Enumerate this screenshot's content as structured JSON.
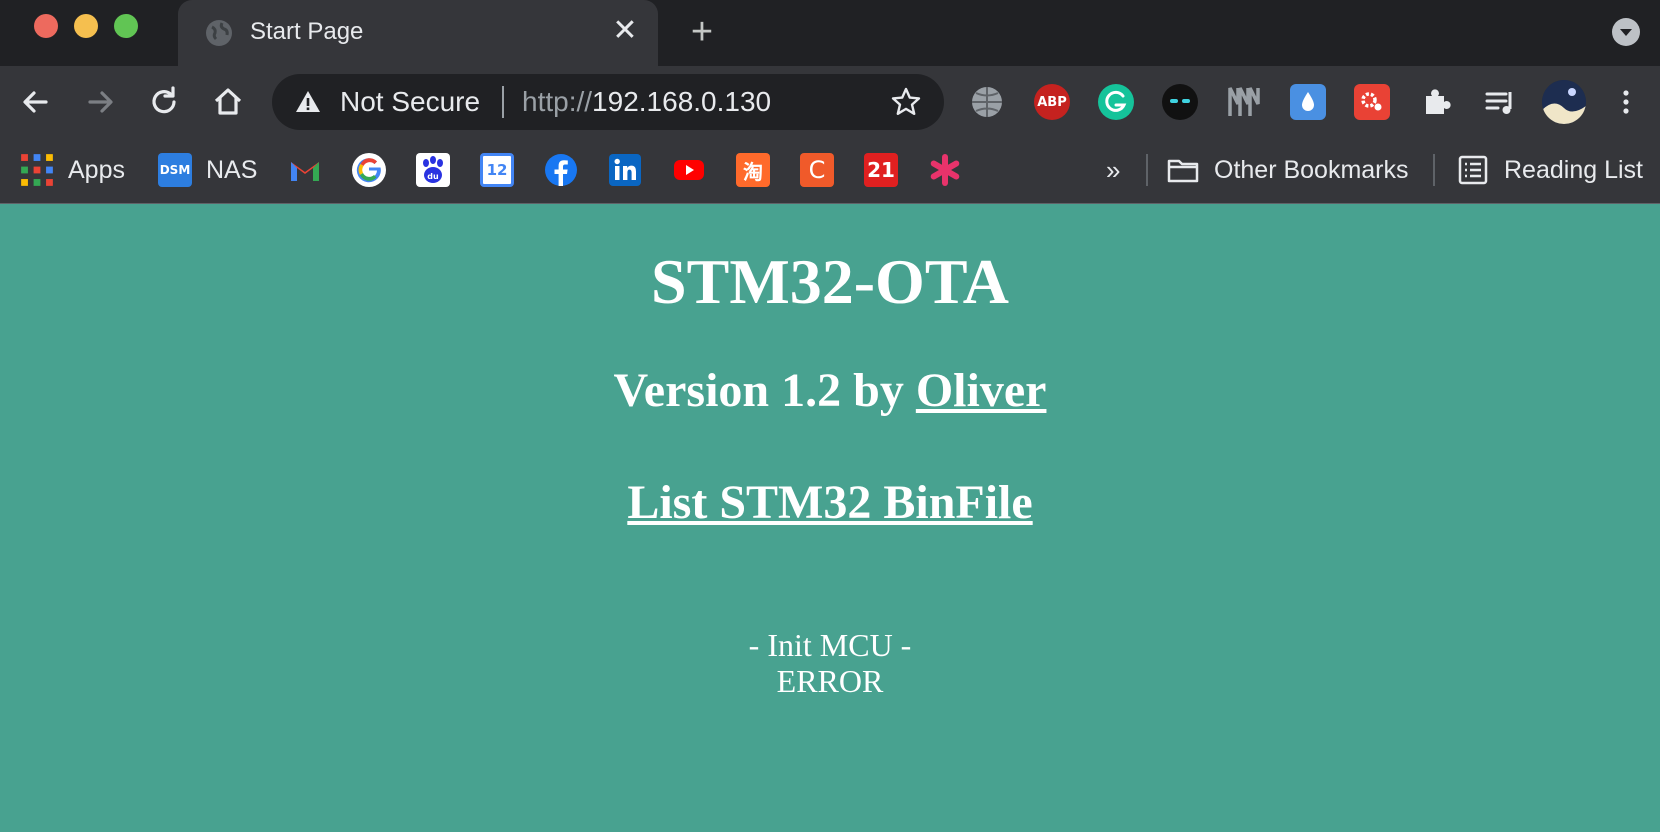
{
  "tab": {
    "title": "Start Page"
  },
  "omnibox": {
    "security": "Not Secure",
    "url_scheme": "http://",
    "url_host": "192.168.0.130"
  },
  "bookmarks": {
    "apps": "Apps",
    "nas": "NAS",
    "nas_icon": "DSM",
    "calendar_day": "12",
    "ext_21": "21",
    "ext_c": "C",
    "ext_tao": "淘",
    "more": "»",
    "other": "Other Bookmarks",
    "reading": "Reading List"
  },
  "extensions": {
    "abp": "ABP"
  },
  "page": {
    "title": "STM32-OTA",
    "version_prefix": "Version 1.2 by ",
    "author": "Oliver",
    "list_link": "List STM32 BinFile",
    "status_line1": "- Init MCU -",
    "status_line2": "ERROR"
  },
  "colors": {
    "page_background": "#48a290",
    "chrome_dark": "#202124",
    "chrome_toolbar": "#35363a"
  }
}
